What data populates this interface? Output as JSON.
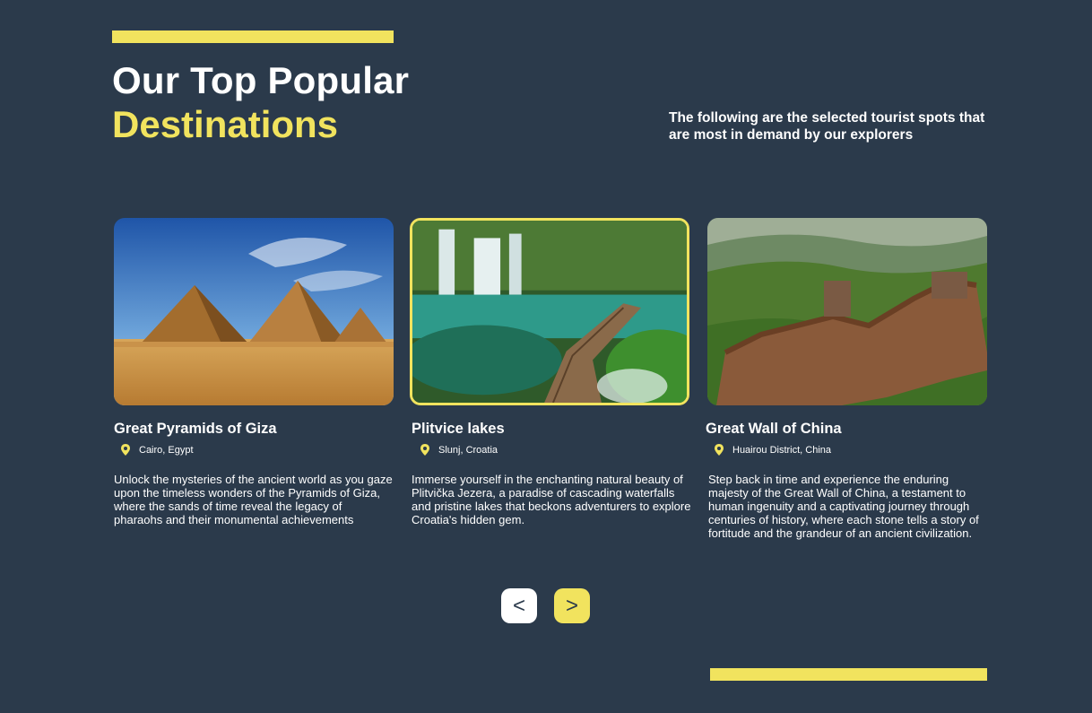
{
  "header": {
    "title_line1": "Our Top Popular",
    "title_line2": "Destinations",
    "subtitle": "The following are the selected tourist spots that are most in demand by our explorers"
  },
  "cards": [
    {
      "title": "Great Pyramids of Giza",
      "location": "Cairo, Egypt",
      "description": "Unlock the mysteries of the ancient world as you gaze upon the timeless wonders of the Pyramids of Giza, where the sands of time reveal the legacy of pharaohs and their monumental achievements",
      "icon": "pin-icon",
      "active": false
    },
    {
      "title": "Plitvice lakes",
      "location": "Slunj, Croatia",
      "description": "Immerse yourself in the enchanting natural beauty of Plitvička Jezera, a paradise of cascading waterfalls and pristine lakes that beckons adventurers to explore Croatia's hidden gem.",
      "icon": "pin-icon",
      "active": true
    },
    {
      "title": "Great Wall of China",
      "location": "Huairou District, China",
      "description": "Step back in time and experience the enduring majesty of the Great Wall of China, a testament to human ingenuity and a captivating journey through centuries of history, where each stone tells a story of fortitude and the grandeur of an ancient civilization.",
      "icon": "pin-icon",
      "active": false
    }
  ],
  "nav": {
    "prev_label": "<",
    "next_label": ">"
  },
  "colors": {
    "background": "#2b3a4b",
    "accent": "#f1e35e",
    "text": "#ffffff"
  }
}
